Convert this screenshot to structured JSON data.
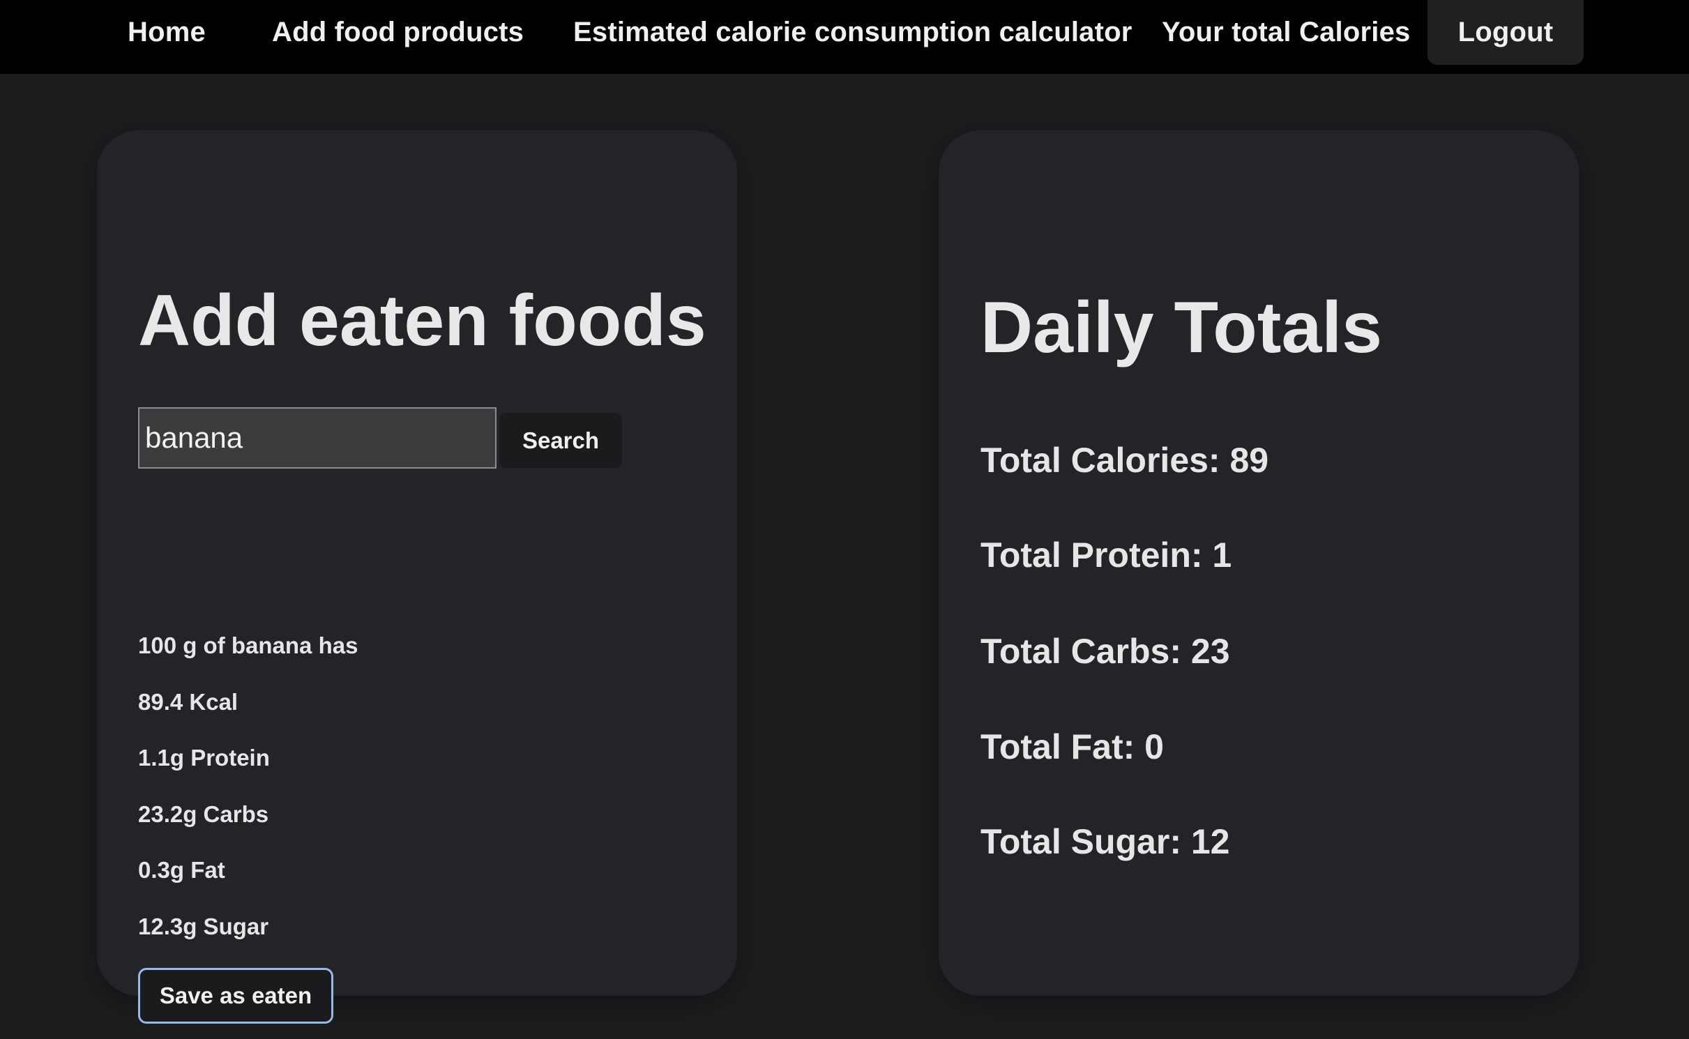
{
  "nav": {
    "home": "Home",
    "add_food": "Add food products",
    "calculator": "Estimated calorie consumption calculator",
    "total_calories": "Your total Calories",
    "logout": "Logout"
  },
  "add_panel": {
    "title": "Add eaten foods",
    "search_value": "banana",
    "search_button": "Search",
    "results": [
      "100 g of banana has",
      "89.4 Kcal",
      "1.1g Protein",
      "23.2g Carbs",
      "0.3g Fat",
      "12.3g Sugar"
    ],
    "save_button": "Save as eaten"
  },
  "totals_panel": {
    "title": "Daily Totals",
    "lines": [
      "Total Calories: 89",
      "Total Protein: 1",
      "Total Carbs: 23",
      "Total Fat: 0",
      "Total Sugar: 12"
    ]
  },
  "colors": {
    "page_background": "#1c1d1f",
    "nav_background": "#000000",
    "card_background": "#232427",
    "input_background": "#3c3c3e",
    "button_background": "#1b1b1d",
    "focus_outline": "#9bb7e6",
    "text": "#e6e6e6"
  }
}
